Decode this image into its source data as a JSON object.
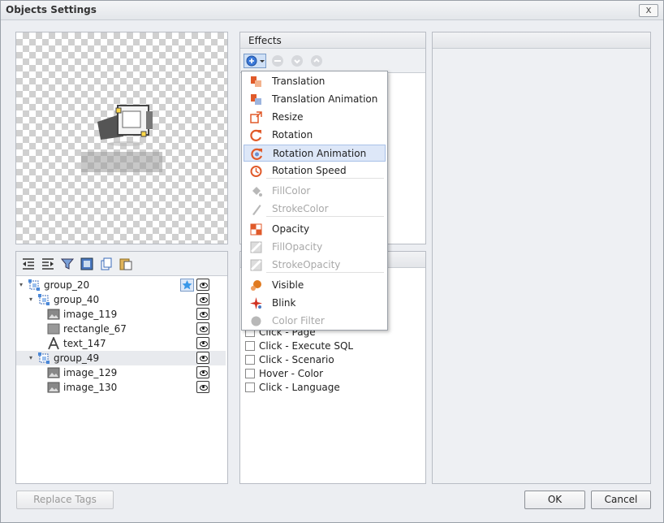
{
  "window": {
    "title": "Objects Settings",
    "close_label": "x"
  },
  "effects_panel": {
    "header": "Effects"
  },
  "effects_menu": {
    "items": [
      {
        "label": "Translation",
        "icon": "translation-icon",
        "color": "#e05a2a",
        "disabled": false
      },
      {
        "label": "Translation Animation",
        "icon": "translation-animation-icon",
        "color": "#e05a2a",
        "disabled": false
      },
      {
        "label": "Resize",
        "icon": "resize-icon",
        "color": "#e05a2a",
        "disabled": false
      },
      {
        "label": "Rotation",
        "icon": "rotation-icon",
        "color": "#e05a2a",
        "disabled": false
      },
      {
        "label": "Rotation Animation",
        "icon": "rotation-animation-icon",
        "color": "#e05a2a",
        "disabled": false
      },
      {
        "label": "Rotation Speed",
        "icon": "rotation-speed-icon",
        "color": "#e05a2a",
        "disabled": false
      },
      {
        "label": "FillColor",
        "icon": "fill-color-icon",
        "disabled": true
      },
      {
        "label": "StrokeColor",
        "icon": "stroke-color-icon",
        "disabled": true
      },
      {
        "label": "Opacity",
        "icon": "opacity-icon",
        "color": "#e05a2a",
        "disabled": false
      },
      {
        "label": "FillOpacity",
        "icon": "fill-opacity-icon",
        "disabled": true
      },
      {
        "label": "StrokeOpacity",
        "icon": "stroke-opacity-icon",
        "disabled": true
      },
      {
        "label": "Visible",
        "icon": "visible-icon",
        "color": "#e07a20",
        "disabled": false
      },
      {
        "label": "Blink",
        "icon": "blink-icon",
        "color": "#d03020",
        "disabled": false
      },
      {
        "label": "Color Filter",
        "icon": "color-filter-icon",
        "disabled": true
      }
    ]
  },
  "events_list": {
    "items": [
      {
        "label": "Click - Page"
      },
      {
        "label": "Click - Execute SQL"
      },
      {
        "label": "Click - Scenario"
      },
      {
        "label": "Hover - Color"
      },
      {
        "label": "Click - Language"
      }
    ]
  },
  "tree": {
    "items": [
      {
        "label": "group_20",
        "depth": 0,
        "type": "group",
        "expander": true
      },
      {
        "label": "group_40",
        "depth": 1,
        "type": "group",
        "expander": true
      },
      {
        "label": "image_119",
        "depth": 2,
        "type": "image",
        "expander": false
      },
      {
        "label": "rectangle_67",
        "depth": 2,
        "type": "rectangle",
        "expander": false
      },
      {
        "label": "text_147",
        "depth": 2,
        "type": "text",
        "expander": false
      },
      {
        "label": "group_49",
        "depth": 1,
        "type": "group",
        "expander": true,
        "selected": true
      },
      {
        "label": "image_129",
        "depth": 2,
        "type": "image",
        "expander": false
      },
      {
        "label": "image_130",
        "depth": 2,
        "type": "image",
        "expander": false
      }
    ]
  },
  "buttons": {
    "replace_tags": "Replace Tags",
    "ok": "OK",
    "cancel": "Cancel"
  },
  "colors": {
    "accent": "#3a78d8",
    "highlight": "#dde7f8"
  }
}
